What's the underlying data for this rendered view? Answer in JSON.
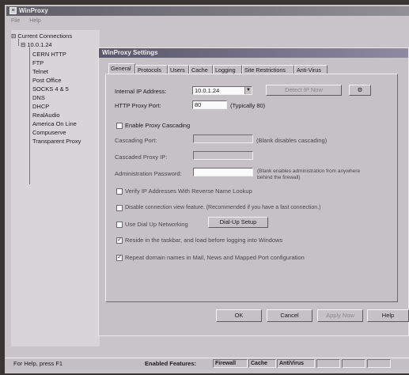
{
  "app": {
    "title": "WinProxy",
    "menu": [
      "File",
      "Help"
    ]
  },
  "tree": {
    "root": "Current Connections",
    "host": "10.0.1.24",
    "items": [
      "CERN HTTP",
      "FTP",
      "Telnet",
      "Post Office",
      "SOCKS 4 & 5",
      "DNS",
      "DHCP",
      "RealAudio",
      "America On Line",
      "Compuserve",
      "Transparent Proxy"
    ]
  },
  "dialog": {
    "title": "WinProxy Settings",
    "tabs": [
      "General",
      "Protocols",
      "Users",
      "Cache",
      "Logging",
      "Site Restrictions",
      "Anti-Virus"
    ],
    "internal_ip_label": "Internal IP Address:",
    "internal_ip_value": "10.0.1.24",
    "detect_button": "Detect IP Now",
    "http_port_label": "HTTP Proxy Port:",
    "http_port_value": "80",
    "http_port_hint": "(Typically 80)",
    "enable_cascading": "Enable Proxy Cascading",
    "cascading_port_label": "Cascading Port:",
    "cascading_port_hint": "(Blank disables cascading)",
    "cascaded_ip_label": "Cascaded Proxy IP:",
    "admin_password_label": "Administration Password:",
    "admin_password_hint_1": "(Blank enables administration from anywhere",
    "admin_password_hint_2": "behind the firewall)",
    "verify_ip": "Verify IP Addresses With Reverse Name Lookup",
    "disable_conn": "Disable connection view feature. (Recommended if you have a fast connection.)",
    "use_dialup": "Use Dial Up Networking",
    "dialup_button": "Dial-Up Setup",
    "reside_tray": "Reside in the taskbar, and load before logging into Windows",
    "repeat_domain": "Repeat domain names in Mail, News and Mapped Port configuration",
    "buttons": {
      "ok": "OK",
      "cancel": "Cancel",
      "apply": "Apply Now",
      "help": "Help"
    }
  },
  "status": {
    "help": "For Help, press F1",
    "enabled_label": "Enabled Features:",
    "features": [
      "Firewall",
      "Cache",
      "AntiVirus"
    ]
  },
  "colors": {
    "titlebar": "#5f5e66",
    "dialog_bg": "#c6c1c4",
    "field_bg": "#fbfbfb"
  }
}
